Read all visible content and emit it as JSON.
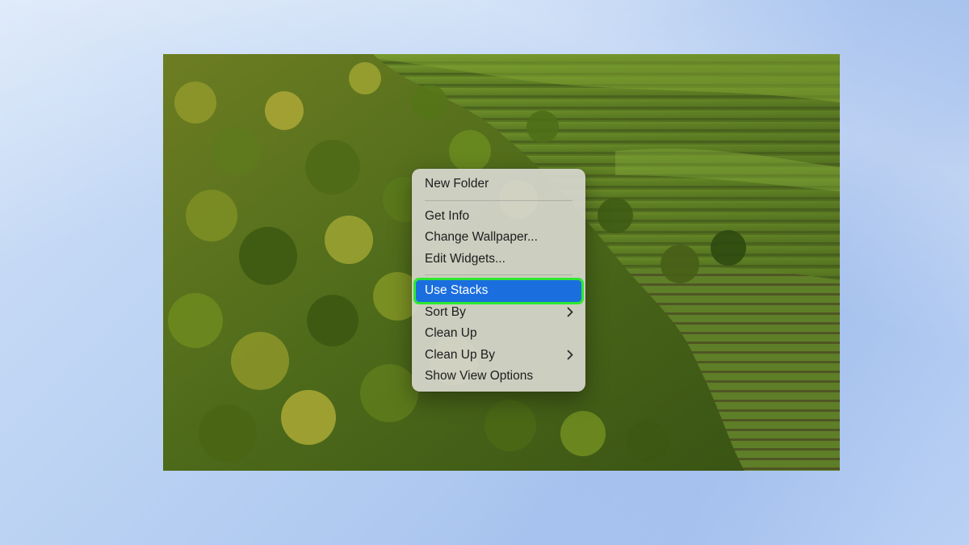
{
  "screen": {
    "background_color": "#bcd3f3",
    "wallpaper_description_colors": {
      "forest_dark": "#2f4a14",
      "forest_mid": "#5c7a22",
      "forest_light": "#a3a235",
      "field_green": "#6f8f2c",
      "field_stripe": "#4a5f1e"
    }
  },
  "context_menu": {
    "groups": [
      [
        {
          "label": "New Folder",
          "has_submenu": false
        }
      ],
      [
        {
          "label": "Get Info",
          "has_submenu": false
        },
        {
          "label": "Change Wallpaper...",
          "has_submenu": false
        },
        {
          "label": "Edit Widgets...",
          "has_submenu": false
        }
      ],
      [
        {
          "label": "Use Stacks",
          "has_submenu": false,
          "highlighted": true
        },
        {
          "label": "Sort By",
          "has_submenu": true
        },
        {
          "label": "Clean Up",
          "has_submenu": false
        },
        {
          "label": "Clean Up By",
          "has_submenu": true
        },
        {
          "label": "Show View Options",
          "has_submenu": false
        }
      ]
    ],
    "highlight_color": "#1b6ede",
    "callout_outline_color": "#2ee830",
    "submenu_icon": "chevron-right-icon"
  }
}
